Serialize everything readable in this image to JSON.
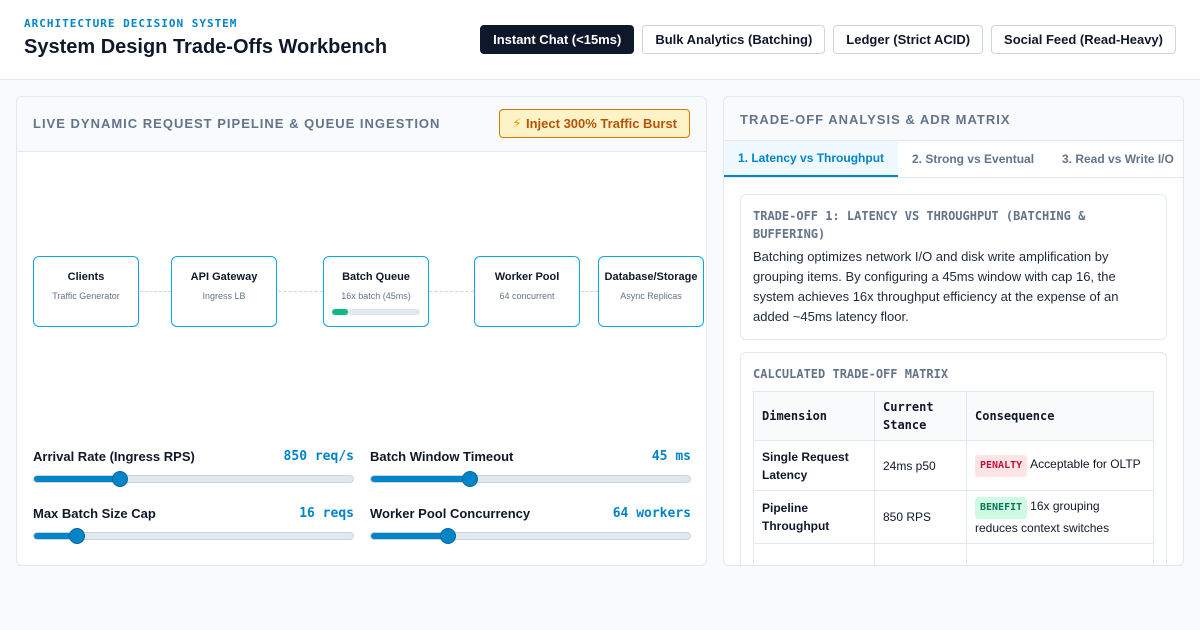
{
  "header": {
    "eyebrow": "ARCHITECTURE DECISION SYSTEM",
    "title": "System Design Trade-Offs Workbench",
    "presets": [
      {
        "label": "Instant Chat (<15ms)",
        "active": true
      },
      {
        "label": "Bulk Analytics (Batching)",
        "active": false
      },
      {
        "label": "Ledger (Strict ACID)",
        "active": false
      },
      {
        "label": "Social Feed (Read-Heavy)",
        "active": false
      }
    ]
  },
  "pipeline_panel": {
    "title": "LIVE DYNAMIC REQUEST PIPELINE & QUEUE INGESTION",
    "burst_button": "Inject 300% Traffic Burst",
    "burst_icon": "lightning-bolt-icon",
    "nodes": [
      {
        "name": "Clients",
        "sub": "Traffic Generator"
      },
      {
        "name": "API Gateway",
        "sub": "Ingress LB"
      },
      {
        "name": "Batch Queue",
        "sub": "16x batch (45ms)",
        "fill_fraction": 0.18
      },
      {
        "name": "Worker Pool",
        "sub": "64 concurrent"
      },
      {
        "name": "Database/Storage",
        "sub": "Async Replicas"
      }
    ],
    "controls": [
      {
        "label": "Arrival Rate (Ingress RPS)",
        "value": "850 req/s",
        "level": 0.27
      },
      {
        "label": "Batch Window Timeout",
        "value": "45 ms",
        "level": 0.31
      },
      {
        "label": "Max Batch Size Cap",
        "value": "16 reqs",
        "level": 0.135
      },
      {
        "label": "Worker Pool Concurrency",
        "value": "64 workers",
        "level": 0.24
      }
    ]
  },
  "analysis_panel": {
    "title": "TRADE-OFF ANALYSIS & ADR MATRIX",
    "tabs": [
      {
        "label": "1. Latency vs Throughput",
        "active": true
      },
      {
        "label": "2. Strong vs Eventual",
        "active": false
      },
      {
        "label": "3. Read vs Write I/O",
        "active": false
      }
    ],
    "explain_heading": "TRADE-OFF 1: LATENCY VS THROUGHPUT (BATCHING & BUFFERING)",
    "explain_text": "Batching optimizes network I/O and disk write amplification by grouping items. By configuring a 45ms window with cap 16, the system achieves 16x throughput efficiency at the expense of an added ~45ms latency floor.",
    "matrix_heading": "CALCULATED TRADE-OFF MATRIX",
    "matrix_columns": [
      "Dimension",
      "Current Stance",
      "Consequence"
    ],
    "matrix_rows": [
      {
        "dimension": "Single Request Latency",
        "stance": "24ms p50",
        "tag": "PENALTY",
        "tag_kind": "penalty",
        "consequence": "Acceptable for OLTP"
      },
      {
        "dimension": "Pipeline Throughput",
        "stance": "850 RPS",
        "tag": "BENEFIT",
        "tag_kind": "benefit",
        "consequence": "16x grouping reduces context switches"
      },
      {
        "dimension": "",
        "stance": "",
        "tag": "",
        "tag_kind": "",
        "consequence": ""
      }
    ]
  },
  "colors": {
    "accent": "#0284c7",
    "dark": "#0f172a",
    "warning_bg": "#fef3c7",
    "warning_text": "#b45309",
    "success": "#10b981",
    "penalty": "#be123c"
  }
}
